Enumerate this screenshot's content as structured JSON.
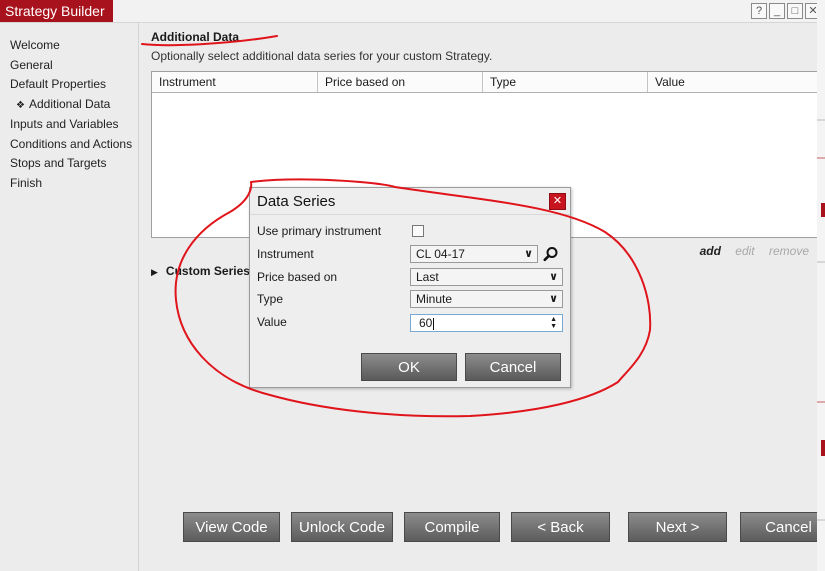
{
  "window": {
    "title": "Strategy Builder",
    "controls": [
      "?",
      "_",
      "□",
      "✕"
    ],
    "accent": "#a8121c"
  },
  "sidebar": {
    "items": [
      {
        "label": "Welcome"
      },
      {
        "label": "General"
      },
      {
        "label": "Default Properties"
      },
      {
        "label": "Additional Data",
        "active": true
      },
      {
        "label": "Inputs and Variables"
      },
      {
        "label": "Conditions and Actions"
      },
      {
        "label": "Stops and Targets"
      },
      {
        "label": "Finish"
      }
    ]
  },
  "main": {
    "title": "Additional Data",
    "description": "Optionally select additional data series for your custom Strategy.",
    "table": {
      "columns": [
        "Instrument",
        "Price based on",
        "Type",
        "Value"
      ],
      "rows": []
    },
    "actions": {
      "add": "add",
      "edit": "edit",
      "remove": "remove"
    },
    "custom_series_label": "Custom Series"
  },
  "footer": {
    "buttons": [
      "View Code",
      "Unlock Code",
      "Compile",
      "< Back",
      "Next >",
      "Cancel"
    ]
  },
  "dialog": {
    "title": "Data Series",
    "fields": {
      "use_primary_label": "Use primary instrument",
      "use_primary_checked": false,
      "instrument_label": "Instrument",
      "instrument_value": "CL 04-17",
      "price_label": "Price based on",
      "price_value": "Last",
      "type_label": "Type",
      "type_value": "Minute",
      "value_label": "Value",
      "value_value": "60"
    },
    "ok_label": "OK",
    "cancel_label": "Cancel"
  },
  "annotation_color": "#e0141b",
  "icons": {
    "help": "help-icon",
    "minimize": "minimize-icon",
    "maximize": "maximize-icon",
    "close": "close-icon",
    "search": "search-icon"
  }
}
